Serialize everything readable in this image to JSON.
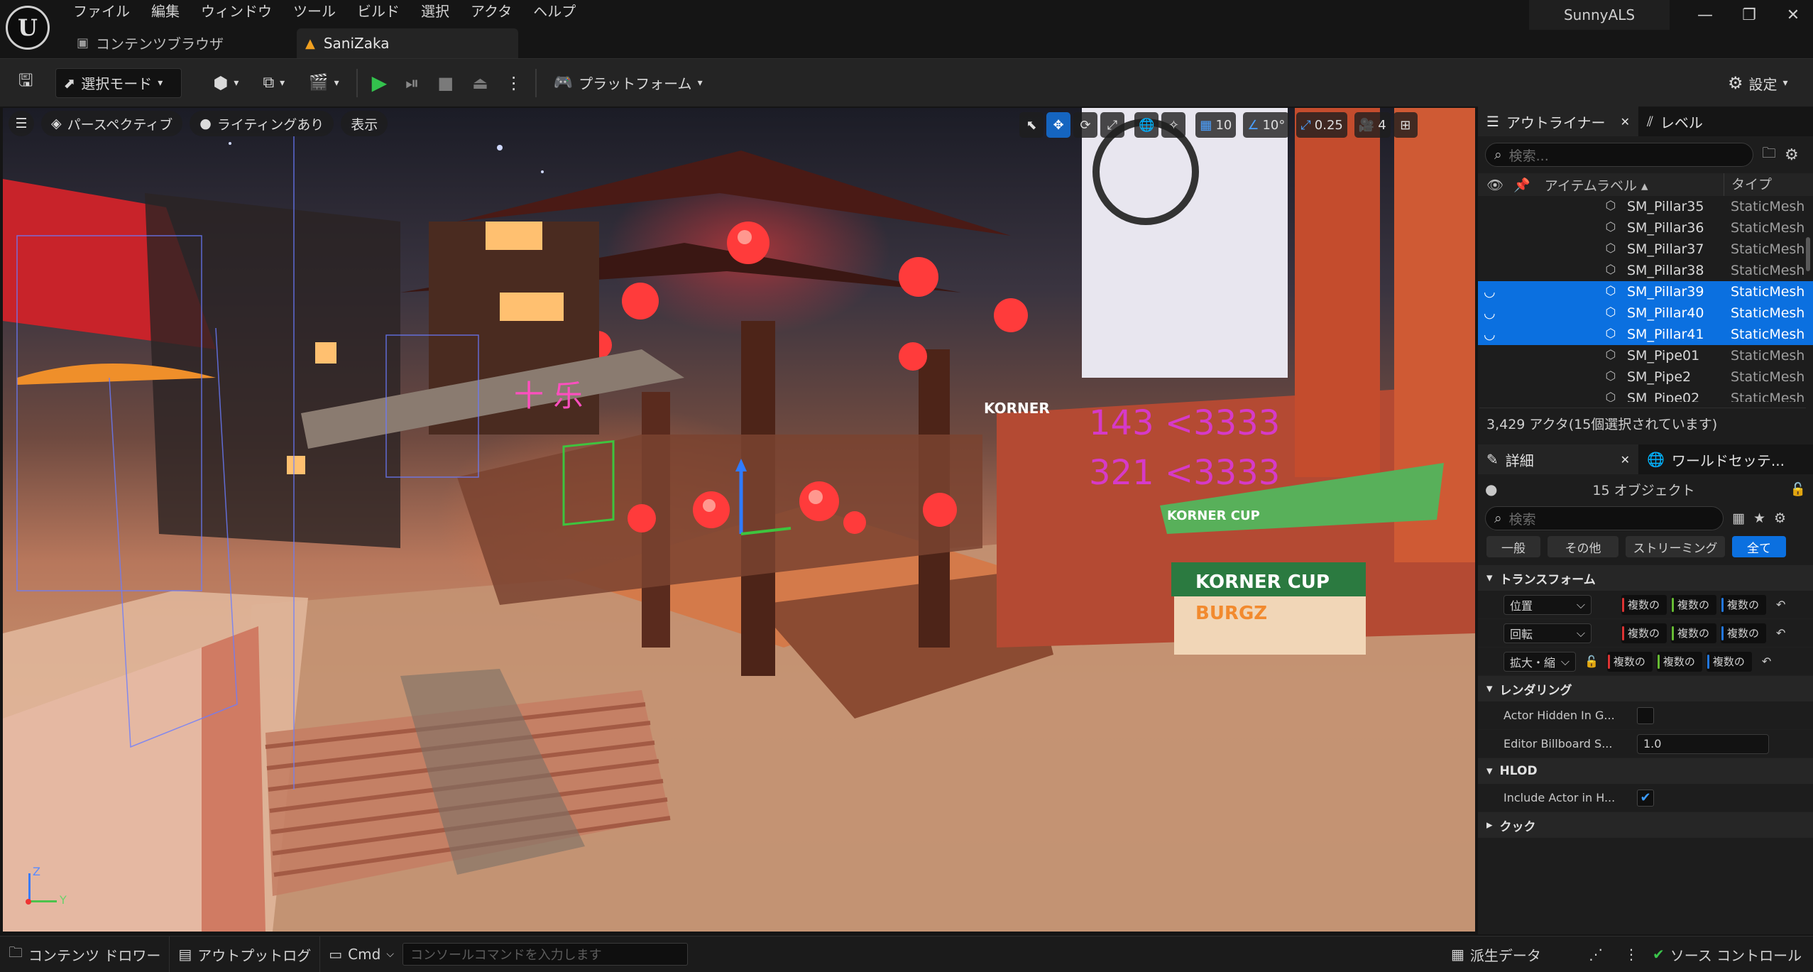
{
  "app": {
    "logo": "U",
    "menu": [
      "ファイル",
      "編集",
      "ウィンドウ",
      "ツール",
      "ビルド",
      "選択",
      "アクタ",
      "ヘルプ"
    ],
    "project_name": "SunnyALS",
    "tabs": {
      "content_browser": "コンテンツブラウザ",
      "level": "SaniZaka"
    },
    "window_controls": {
      "minimize": "—",
      "restore": "❐",
      "close": "✕"
    }
  },
  "toolbar": {
    "select_mode": "選択モード",
    "platform": "プラットフォーム",
    "settings": "設定",
    "icons": [
      "save-icon",
      "add-actor-icon",
      "blueprint-icon",
      "cinematics-icon",
      "play-icon",
      "step-icon",
      "stop-icon",
      "eject-icon",
      "more-icon",
      "platform-icon",
      "gear-icon"
    ]
  },
  "viewport": {
    "perspective": "パースペクティブ",
    "lighting": "ライティングあり",
    "show": "表示",
    "grid_snap": "10",
    "rotation_snap": "10°",
    "scale_snap": "0.25",
    "camera_speed": "4",
    "axis": {
      "z": "Z",
      "y": "Y"
    }
  },
  "outliner": {
    "tab_label": "アウトライナー",
    "level_tab_label": "レベル",
    "search_placeholder": "検索...",
    "col_label": "アイテムラベル ▴",
    "col_type": "タイプ",
    "rows": [
      {
        "name": "SM_Pillar35",
        "type": "StaticMesh",
        "selected": false
      },
      {
        "name": "SM_Pillar36",
        "type": "StaticMesh",
        "selected": false
      },
      {
        "name": "SM_Pillar37",
        "type": "StaticMesh",
        "selected": false
      },
      {
        "name": "SM_Pillar38",
        "type": "StaticMesh",
        "selected": false
      },
      {
        "name": "SM_Pillar39",
        "type": "StaticMesh",
        "selected": true
      },
      {
        "name": "SM_Pillar40",
        "type": "StaticMesh",
        "selected": true
      },
      {
        "name": "SM_Pillar41",
        "type": "StaticMesh",
        "selected": true
      },
      {
        "name": "SM_Pipe01",
        "type": "StaticMesh",
        "selected": false
      },
      {
        "name": "SM_Pipe2",
        "type": "StaticMesh",
        "selected": false
      },
      {
        "name": "SM_Pipe02",
        "type": "StaticMesh",
        "selected": false
      }
    ],
    "status": "3,429 アクタ(15個選択されています)"
  },
  "details": {
    "tab_label": "詳細",
    "world_settings_label": "ワールドセッテ...",
    "object_count": "15 オブジェクト",
    "search_placeholder": "検索",
    "filters": [
      "一般",
      "その他",
      "ストリーミング",
      "全て"
    ],
    "active_filter": 3,
    "transform": {
      "title": "トランスフォーム",
      "rows": [
        {
          "label": "位置",
          "x": "複数の",
          "y": "複数の",
          "z": "複数の"
        },
        {
          "label": "回転",
          "x": "複数の",
          "y": "複数の",
          "z": "複数の"
        },
        {
          "label": "拡大・縮",
          "x": "複数の",
          "y": "複数の",
          "z": "複数の"
        }
      ]
    },
    "rendering": {
      "title": "レンダリング",
      "actor_hidden_label": "Actor Hidden In G...",
      "billboard_label": "Editor Billboard S...",
      "billboard_value": "1.0"
    },
    "hlod": {
      "title": "HLOD",
      "include_label": "Include Actor in H...",
      "include_checked": true
    },
    "cook": {
      "title": "クック"
    }
  },
  "statusbar": {
    "content_drawer": "コンテンツ ドロワー",
    "output_log": "アウトプットログ",
    "cmd": "Cmd",
    "console_placeholder": "コンソールコマンドを入力します",
    "derived_data": "派生データ",
    "source_control": "ソース コントロール"
  }
}
